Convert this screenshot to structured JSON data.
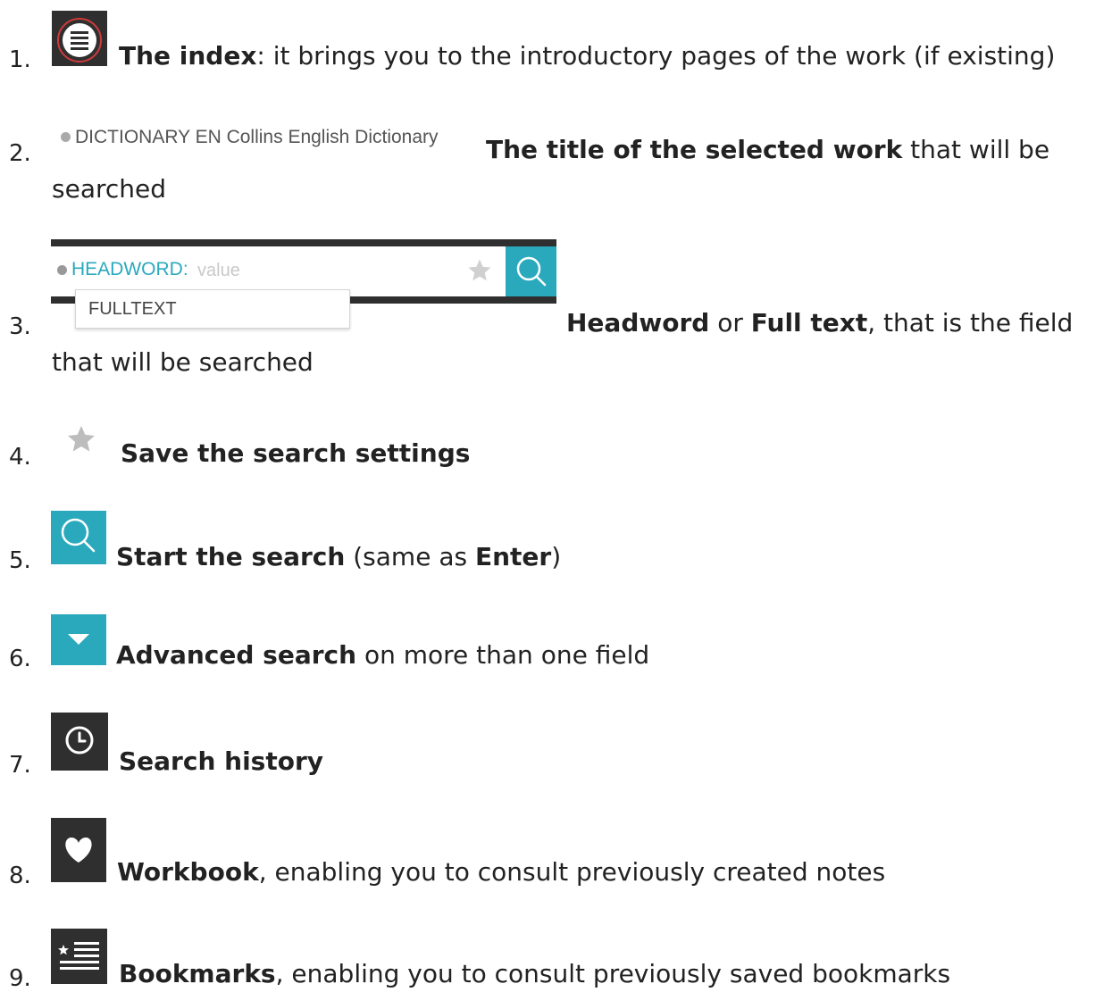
{
  "items": [
    {
      "number": "1.",
      "bold": "The index",
      "rest": ": it brings you to the introductory pages of the work (if existing)"
    },
    {
      "number": "2.",
      "widget_text": "DICTIONARY  EN Collins English Dictionary",
      "bold": "The title of the selected work",
      "rest": " that will be",
      "rest2": "searched"
    },
    {
      "number": "3.",
      "field_label": "HEADWORD:",
      "field_placeholder": "value",
      "dropdown_option": "FULLTEXT",
      "bold": "Headword",
      "mid": " or ",
      "bold2": "Full text",
      "rest": ", that is the field",
      "rest2": "that will be searched"
    },
    {
      "number": "4.",
      "bold": "Save the search settings"
    },
    {
      "number": "5.",
      "bold": "Start the search",
      "mid": " (same as ",
      "bold2": "Enter",
      "rest": ")"
    },
    {
      "number": "6.",
      "bold": "Advanced search",
      "rest": " on more than one field"
    },
    {
      "number": "7.",
      "bold": "Search history"
    },
    {
      "number": "8.",
      "bold": "Workbook",
      "rest": ", enabling you to consult previously created notes"
    },
    {
      "number": "9.",
      "bold": "Bookmarks",
      "rest": ", enabling you to consult previously saved bookmarks"
    }
  ],
  "colors": {
    "accent": "#2aa9bd",
    "icon_bg": "#2f2f2f",
    "index_ring": "#cf3a3a",
    "star": "#c8c8c8"
  }
}
